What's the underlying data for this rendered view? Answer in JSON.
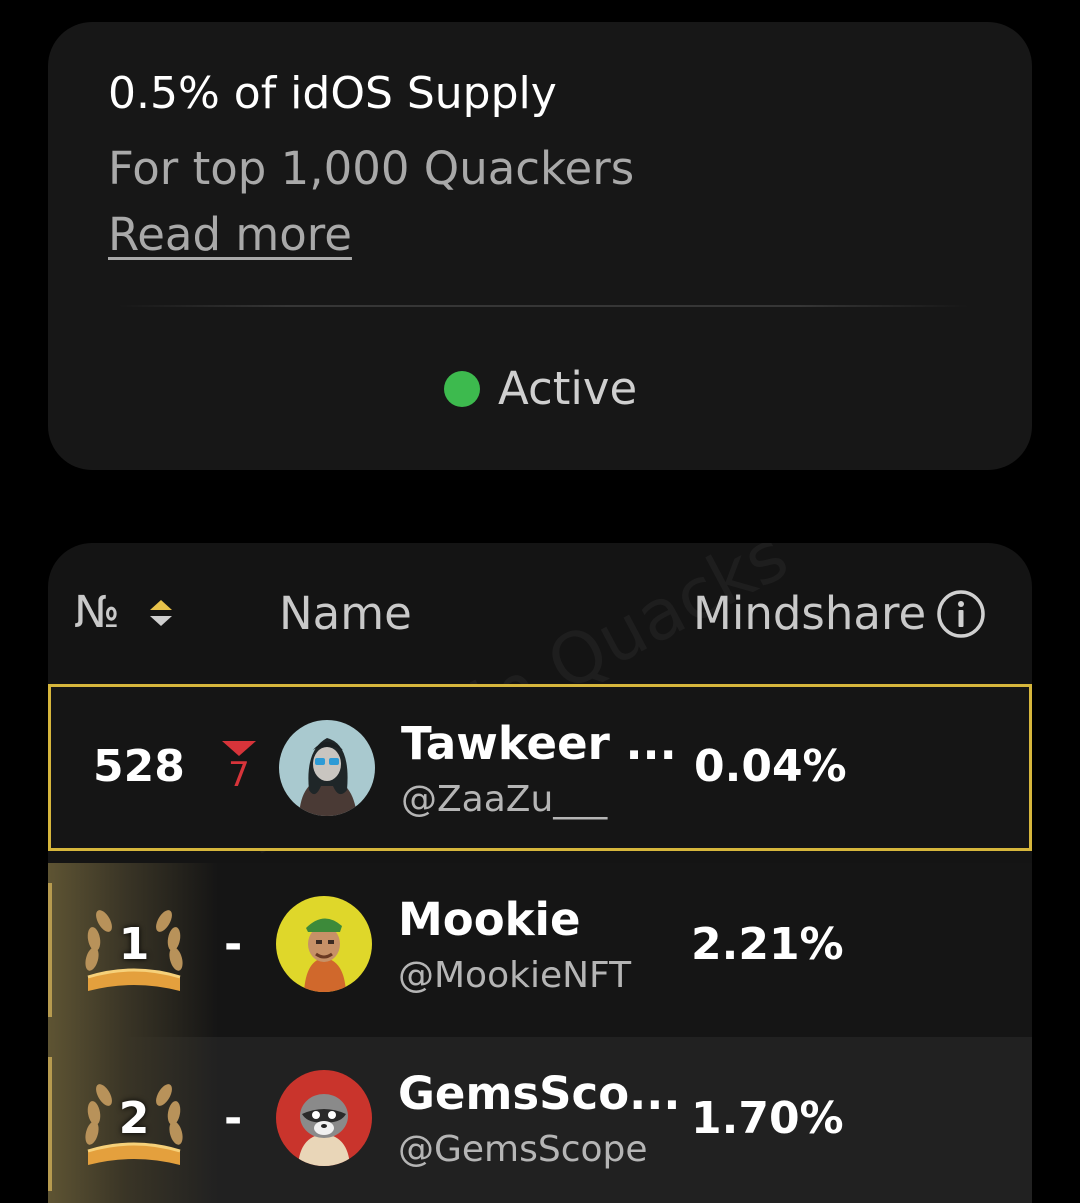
{
  "reward": {
    "title": "0.5% of idOS Supply",
    "subtitle": "For top 1,000 Quackers",
    "read_more": "Read more",
    "status": "Active",
    "status_color": "#3dba4e"
  },
  "leaderboard": {
    "headers": {
      "rank": "№",
      "name": "Name",
      "mindshare": "Mindshare"
    },
    "watermark": "Wallchain Quacks",
    "rows": [
      {
        "rank": "528",
        "change": "7",
        "change_direction": "down",
        "name": "Tawkeer ...",
        "handle": "@ZaaZu___",
        "mindshare": "0.04%",
        "highlighted": true
      },
      {
        "rank": "1",
        "change": "-",
        "name": "Mookie",
        "handle": "@MookieNFT",
        "mindshare": "2.21%",
        "badge": "gold-laurel"
      },
      {
        "rank": "2",
        "change": "-",
        "name": "GemsSco...",
        "handle": "@GemsScope",
        "mindshare": "1.70%",
        "badge": "gold-laurel"
      }
    ]
  },
  "colors": {
    "highlight_border": "#d6b63c",
    "rank_down": "#d7343a",
    "sort_icon_yellow": "#e8c24a"
  }
}
